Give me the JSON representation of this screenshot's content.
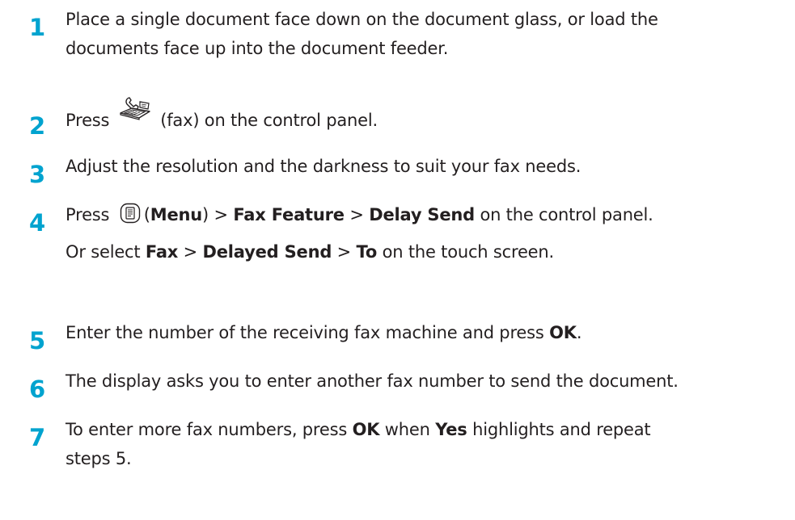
{
  "steps": [
    {
      "number": "1",
      "line1": "Place a single document face down on the document glass, or load the",
      "line2": "documents face up into the document feeder."
    },
    {
      "number": "2",
      "before": "Press",
      "icon": "fax-icon",
      "after": "(fax) on the control panel."
    },
    {
      "number": "3",
      "text": "Adjust the resolution and the darkness to suit your fax needs."
    },
    {
      "number": "4",
      "press": "Press",
      "icon": "menu-icon",
      "paren_open": "(",
      "menu": "Menu",
      "paren_close": ")",
      "sep1": ">",
      "fax_feature": "Fax Feature",
      "sep2": ">",
      "delay_send": "Delay Send",
      "tail": "on the control panel.",
      "or_select": "Or select",
      "fax": "Fax",
      "sep3": ">",
      "delayed_send": "Delayed Send",
      "sep4": ">",
      "to": "To",
      "tail2": "on the touch screen."
    },
    {
      "number": "5",
      "text": "Enter the number of the receiving fax machine and press",
      "ok": "OK",
      "period": "."
    },
    {
      "number": "6",
      "text": "The display asks you to enter another fax number to send the document."
    },
    {
      "number": "7",
      "pre": "To enter more fax numbers, press",
      "ok": "OK",
      "mid": "when",
      "yes": "Yes",
      "post": "highlights and repeat",
      "line2": "steps 5."
    }
  ],
  "colors": {
    "step_number": "#00a3cf",
    "text": "#231f20"
  }
}
